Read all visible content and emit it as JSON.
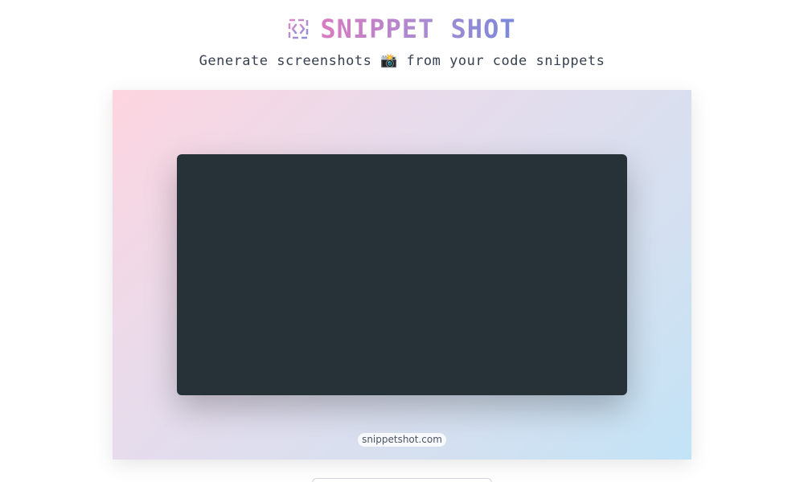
{
  "header": {
    "logo_icon": "code-brackets-icon",
    "title": "SNIPPET SHOT",
    "tagline": "Generate screenshots 📸 from your code snippets"
  },
  "canvas": {
    "gradient_colors": [
      "#fdd5e0",
      "#e6dcec",
      "#c2e3f6"
    ],
    "code_window_color": "#263238",
    "watermark": "snippetshot.com"
  },
  "colors": {
    "title_gradient_start": "#d97bbf",
    "title_gradient_end": "#7b88d9",
    "tagline": "#374151"
  }
}
